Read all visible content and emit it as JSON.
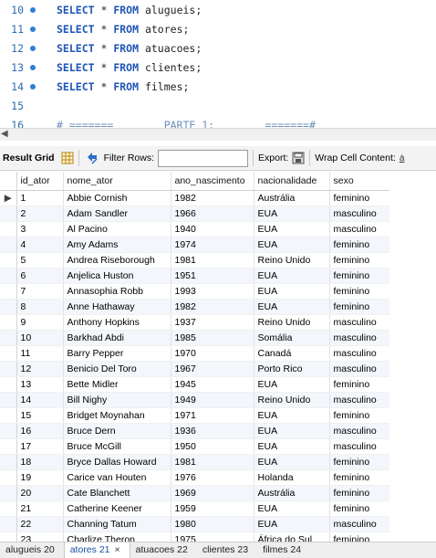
{
  "editor": {
    "lines": [
      {
        "num": "10",
        "keyword1": "SELECT",
        "mid": " * ",
        "keyword2": "FROM",
        "rest": " alugueis;"
      },
      {
        "num": "11",
        "keyword1": "SELECT",
        "mid": " * ",
        "keyword2": "FROM",
        "rest": " atores;"
      },
      {
        "num": "12",
        "keyword1": "SELECT",
        "mid": " * ",
        "keyword2": "FROM",
        "rest": " atuacoes;"
      },
      {
        "num": "13",
        "keyword1": "SELECT",
        "mid": " * ",
        "keyword2": "FROM",
        "rest": " clientes;"
      },
      {
        "num": "14",
        "keyword1": "SELECT",
        "mid": " * ",
        "keyword2": "FROM",
        "rest": " filmes;"
      },
      {
        "num": "15"
      },
      {
        "num": "16",
        "comment": "# =======        PARTE 1:        =======#"
      }
    ]
  },
  "toolbar": {
    "result_grid": "Result Grid",
    "filter_rows": "Filter Rows:",
    "filter_value": "",
    "export": "Export:",
    "wrap": "Wrap Cell Content:",
    "wrap_icon": "ẚ"
  },
  "grid": {
    "columns": [
      "id_ator",
      "nome_ator",
      "ano_nascimento",
      "nacionalidade",
      "sexo"
    ],
    "rows": [
      [
        "1",
        "Abbie Cornish",
        "1982",
        "Austrália",
        "feminino"
      ],
      [
        "2",
        "Adam Sandler",
        "1966",
        "EUA",
        "masculino"
      ],
      [
        "3",
        "Al Pacino",
        "1940",
        "EUA",
        "masculino"
      ],
      [
        "4",
        "Amy Adams",
        "1974",
        "EUA",
        "feminino"
      ],
      [
        "5",
        "Andrea Riseborough",
        "1981",
        "Reino Unido",
        "feminino"
      ],
      [
        "6",
        "Anjelica Huston",
        "1951",
        "EUA",
        "feminino"
      ],
      [
        "7",
        "Annasophia Robb",
        "1993",
        "EUA",
        "feminino"
      ],
      [
        "8",
        "Anne Hathaway",
        "1982",
        "EUA",
        "feminino"
      ],
      [
        "9",
        "Anthony Hopkins",
        "1937",
        "Reino Unido",
        "masculino"
      ],
      [
        "10",
        "Barkhad Abdi",
        "1985",
        "Somália",
        "masculino"
      ],
      [
        "11",
        "Barry Pepper",
        "1970",
        "Canadá",
        "masculino"
      ],
      [
        "12",
        "Benicio Del Toro",
        "1967",
        "Porto Rico",
        "masculino"
      ],
      [
        "13",
        "Bette Midler",
        "1945",
        "EUA",
        "feminino"
      ],
      [
        "14",
        "Bill Nighy",
        "1949",
        "Reino Unido",
        "masculino"
      ],
      [
        "15",
        "Bridget Moynahan",
        "1971",
        "EUA",
        "feminino"
      ],
      [
        "16",
        "Bruce Dern",
        "1936",
        "EUA",
        "masculino"
      ],
      [
        "17",
        "Bruce McGill",
        "1950",
        "EUA",
        "masculino"
      ],
      [
        "18",
        "Bryce Dallas Howard",
        "1981",
        "EUA",
        "feminino"
      ],
      [
        "19",
        "Carice van Houten",
        "1976",
        "Holanda",
        "feminino"
      ],
      [
        "20",
        "Cate Blanchett",
        "1969",
        "Austrália",
        "feminino"
      ],
      [
        "21",
        "Catherine Keener",
        "1959",
        "EUA",
        "feminino"
      ],
      [
        "22",
        "Channing Tatum",
        "1980",
        "EUA",
        "masculino"
      ],
      [
        "23",
        "Charlize Theron",
        "1975",
        "África do Sul",
        "feminino"
      ]
    ]
  },
  "tabs": [
    {
      "label": "alugueis 20",
      "active": false
    },
    {
      "label": "atores 21",
      "active": true,
      "close": "×"
    },
    {
      "label": "atuacoes 22",
      "active": false
    },
    {
      "label": "clientes 23",
      "active": false
    },
    {
      "label": "filmes 24",
      "active": false
    }
  ]
}
